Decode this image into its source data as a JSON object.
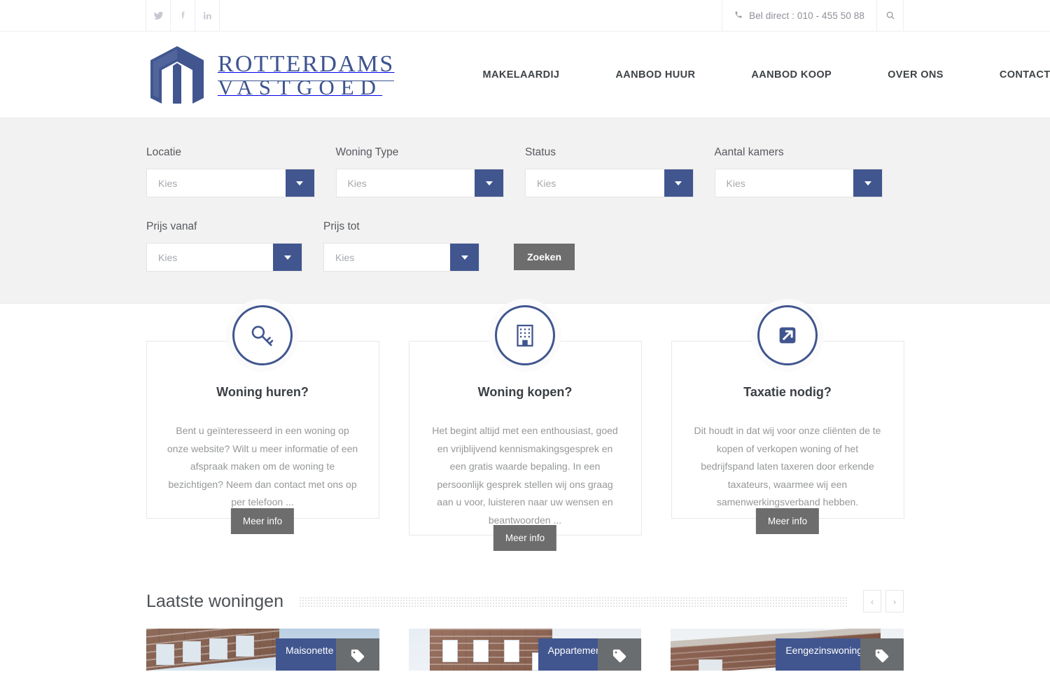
{
  "topbar": {
    "social": [
      {
        "name": "twitter-icon",
        "label": "Twitter"
      },
      {
        "name": "facebook-icon",
        "label": "Facebook"
      },
      {
        "name": "linkedin-icon",
        "label": "LinkedIn"
      }
    ],
    "phone_text": "Bel direct : 010 - 455 50 88",
    "search_icon": "search-icon"
  },
  "header": {
    "logo_line1": "ROTTERDAMS",
    "logo_line2": "VASTGOED",
    "nav": [
      {
        "label": "MAKELAARDIJ"
      },
      {
        "label": "AANBOD HUUR"
      },
      {
        "label": "AANBOD KOOP"
      },
      {
        "label": "OVER ONS"
      },
      {
        "label": "CONTACT"
      }
    ]
  },
  "filters": {
    "row1": [
      {
        "label": "Locatie",
        "value": "Kies"
      },
      {
        "label": "Woning Type",
        "value": "Kies"
      },
      {
        "label": "Status",
        "value": "Kies"
      },
      {
        "label": "Aantal kamers",
        "value": "Kies"
      }
    ],
    "row2": [
      {
        "label": "Prijs vanaf",
        "value": "Kies"
      },
      {
        "label": "Prijs tot",
        "value": "Kies"
      }
    ],
    "submit_label": "Zoeken"
  },
  "services": [
    {
      "icon": "key-icon",
      "title": "Woning huren?",
      "text": "Bent u geïnteresseerd in een woning op onze website? Wilt u meer informatie of een afspraak maken om de woning te bezichtigen? Neem dan contact met ons op per telefoon ...",
      "button": "Meer info"
    },
    {
      "icon": "building-icon",
      "title": "Woning kopen?",
      "text": "Het begint altijd met een enthousiast, goed en vrijblijvend kennismakingsgesprek en een gratis waarde bepaling. In een persoonlijk gesprek stellen wij ons graag aan u voor, luisteren naar uw wensen en beantwoorden ...",
      "button": "Meer info"
    },
    {
      "icon": "external-link-icon",
      "title": "Taxatie nodig?",
      "text": "Dit houdt in dat wij voor onze cliënten de te kopen of verkopen woning of het bedrijfspand laten taxeren door erkende taxateurs, waarmee wij een samenwerkingsverband hebben.",
      "button": "Meer info"
    }
  ],
  "latest": {
    "title": "Laatste woningen",
    "prev_label": "‹",
    "next_label": "›",
    "properties": [
      {
        "type": "Maisonette"
      },
      {
        "type": "Appartement"
      },
      {
        "type": "Eengezinswoning"
      }
    ]
  },
  "colors": {
    "brand_blue": "#41568f",
    "button_grey": "#6d6d6d",
    "panel_grey": "#f2f2f2"
  }
}
